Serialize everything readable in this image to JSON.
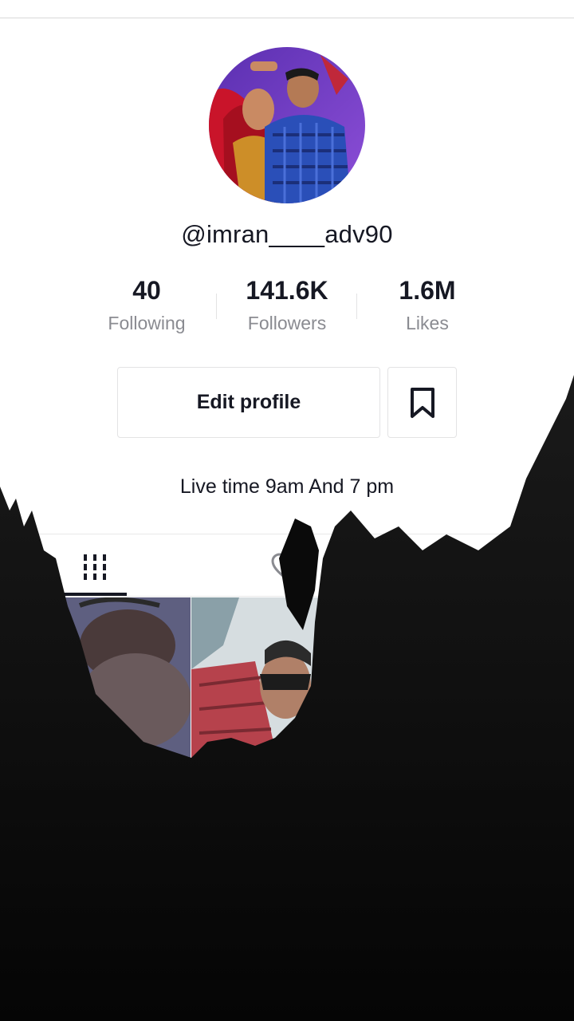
{
  "profile": {
    "username": "@imran____adv90",
    "bio": "Live time 9am And 7 pm"
  },
  "stats": {
    "following": {
      "value": "40",
      "label": "Following"
    },
    "followers": {
      "value": "141.6K",
      "label": "Followers"
    },
    "likes": {
      "value": "1.6M",
      "label": "Likes"
    }
  },
  "actions": {
    "edit_profile_label": "Edit profile",
    "bookmark_icon": "bookmark-icon"
  },
  "tabs": {
    "videos_icon": "grid-icon",
    "liked_icon": "heart-icon",
    "selected": "videos"
  },
  "colors": {
    "text_primary": "#161823",
    "text_secondary": "#8a8b91",
    "border": "#e3e3e4"
  }
}
